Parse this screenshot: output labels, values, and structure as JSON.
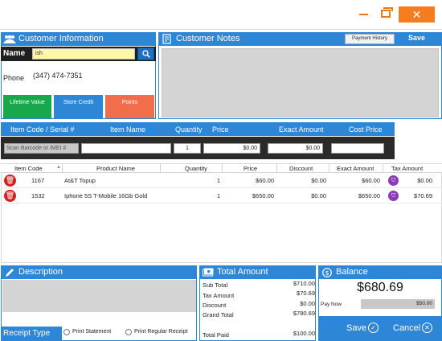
{
  "window": {
    "minimize_icon": "minimize-icon",
    "maximize_icon": "maximize-icon",
    "close_glyph": "✕"
  },
  "customer_info": {
    "title": "Customer Information",
    "name_label": "Name",
    "name_value": "ish",
    "phone_label": "Phone",
    "phone_value": "(347) 474-7351",
    "buttons": {
      "lifetime_value": "Lifetime Value",
      "store_credit": "Store Credit",
      "points": "Points"
    }
  },
  "customer_notes": {
    "title": "Customer Notes",
    "payment_history": "Payment History",
    "save": "Save"
  },
  "item_entry": {
    "headers": [
      "Item Code / Serial #",
      "Item Name",
      "Quantity",
      "Price",
      "Exact Amount",
      "Cost Price"
    ],
    "scan_placeholder": "Scan Barcode or IMEI #",
    "quantity": "1",
    "price": "$0.00",
    "exact_amount": "$0.00"
  },
  "table": {
    "columns": [
      "Item Code",
      "Product Name",
      "Quantity",
      "Price",
      "Discount",
      "Exact Amount",
      "Tax Amount"
    ],
    "rows": [
      {
        "item_code": "1167",
        "product_name": "At&T Topup",
        "quantity": "1",
        "price": "$60.00",
        "discount": "$0.00",
        "exact_amount": "$60.00",
        "tax_amount": "$0.00"
      },
      {
        "item_code": "1532",
        "product_name": "Iphone 5S T-Mobile 16Gb Gold",
        "quantity": "1",
        "price": "$650.00",
        "discount": "$0.00",
        "exact_amount": "$650.00",
        "tax_amount": "$70.69"
      }
    ]
  },
  "description": {
    "title": "Description"
  },
  "receipt_type": {
    "title": "Receipt Type",
    "options": [
      "Print Statement",
      "Print Regular Receipt"
    ]
  },
  "total_amount": {
    "title": "Total Amount",
    "sub_total_label": "Sub Total",
    "sub_total": "$710.00",
    "tax_amount_label": "Tax Amount",
    "tax_amount": "$70.69",
    "discount_label": "Discount",
    "discount": "$0.00",
    "grand_total_label": "Grand Total",
    "grand_total": "$780.69",
    "total_paid_label": "Total Paid",
    "total_paid": "$100.00"
  },
  "balance": {
    "title": "Balance",
    "amount": "$680.69",
    "pay_now_label": "Pay Now",
    "pay_now_value": "$50.00",
    "save": "Save",
    "cancel": "Cancel"
  },
  "colors": {
    "accent": "#2e86d6",
    "close": "#f57c1f",
    "lifetime": "#18a84a",
    "points": "#f26d4a",
    "delete": "#d42020",
    "tax": "#8a3bb8"
  }
}
